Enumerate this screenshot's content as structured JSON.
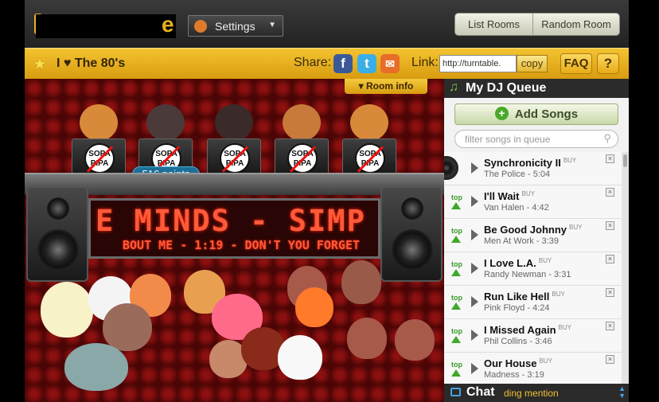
{
  "topbar": {
    "logo_text": "e",
    "settings_label": "Settings",
    "list_rooms_label": "List Rooms",
    "random_room_label": "Random Room"
  },
  "room": {
    "name": "I ♥ The 80's",
    "share_label": "Share:",
    "facebook": "f",
    "twitter": "t",
    "email": "✉",
    "link_label": "Link:",
    "link_value": "http://turntable.",
    "copy_label": "copy",
    "faq_label": "FAQ",
    "help_label": "?"
  },
  "stage": {
    "room_info_label": "▾ Room info",
    "points": "516 points",
    "sticker_text": "SOPA PIPA",
    "marquee_main": "E MINDS - SIMP",
    "marquee_sub": "BOUT ME - 1:19 - DON'T YOU FORGET"
  },
  "queue": {
    "header": "My DJ Queue",
    "add_songs_label": "Add Songs",
    "filter_placeholder": "filter songs in queue",
    "buy_label": "BUY",
    "top_label": "top",
    "songs": [
      {
        "title": "Synchronicity II",
        "artist": "The Police - 5:04",
        "top": false
      },
      {
        "title": "I'll Wait",
        "artist": "Van Halen - 4:42",
        "top": true
      },
      {
        "title": "Be Good Johnny",
        "artist": "Men At Work - 3:39",
        "top": true
      },
      {
        "title": "I Love L.A.",
        "artist": "Randy Newman - 3:31",
        "top": true
      },
      {
        "title": "Run Like Hell",
        "artist": "Pink Floyd - 4:24",
        "top": true
      },
      {
        "title": "I Missed Again",
        "artist": "Phil Collins - 3:46",
        "top": true
      },
      {
        "title": "Our House",
        "artist": "Madness - 3:19",
        "top": true
      }
    ]
  },
  "chat": {
    "label": "Chat",
    "mention_label": "ding mention"
  },
  "colors": {
    "accent": "#e8b020",
    "stage_red": "#5a0606",
    "queue_green": "#3ea82a"
  }
}
